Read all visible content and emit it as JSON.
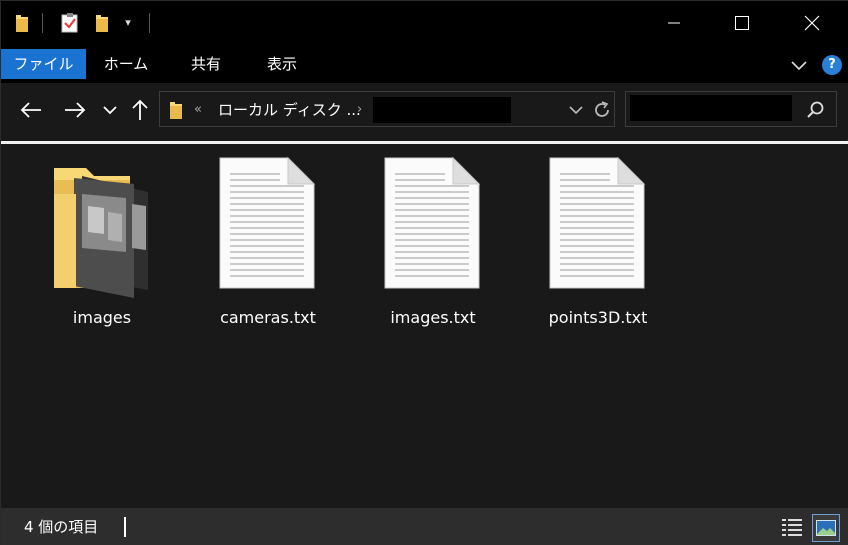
{
  "titlebar": {
    "quick_access_icons": [
      "folder-icon",
      "properties-icon",
      "new-folder-icon",
      "customize-dropdown-icon"
    ],
    "dropdown_glyph": "▾",
    "window_buttons": [
      "minimize-icon",
      "maximize-icon",
      "close-icon"
    ]
  },
  "ribbon": {
    "tabs": [
      "ファイル",
      "ホーム",
      "共有",
      "表示"
    ],
    "help_label": "?",
    "file_tab_color": "#1a73d0"
  },
  "nav": {
    "back_icon": "arrow-left-icon",
    "forward_icon": "arrow-right-icon",
    "recent_icon": "chevron-down-icon",
    "up_icon": "arrow-up-icon",
    "address_prefix": "«",
    "address_text": "ローカル ディスク ...",
    "address_separator": "›"
  },
  "files": [
    {
      "name": "images",
      "type": "folder"
    },
    {
      "name": "cameras.txt",
      "type": "text"
    },
    {
      "name": "images.txt",
      "type": "text"
    },
    {
      "name": "points3D.txt",
      "type": "text"
    }
  ],
  "status": {
    "item_count": "4 個の項目",
    "view_icons": [
      "details-view-icon",
      "large-icons-view-icon"
    ]
  },
  "colors": {
    "background": "#191919",
    "chrome": "#000000",
    "accent": "#1a73d0",
    "folder": "#f8d775"
  }
}
